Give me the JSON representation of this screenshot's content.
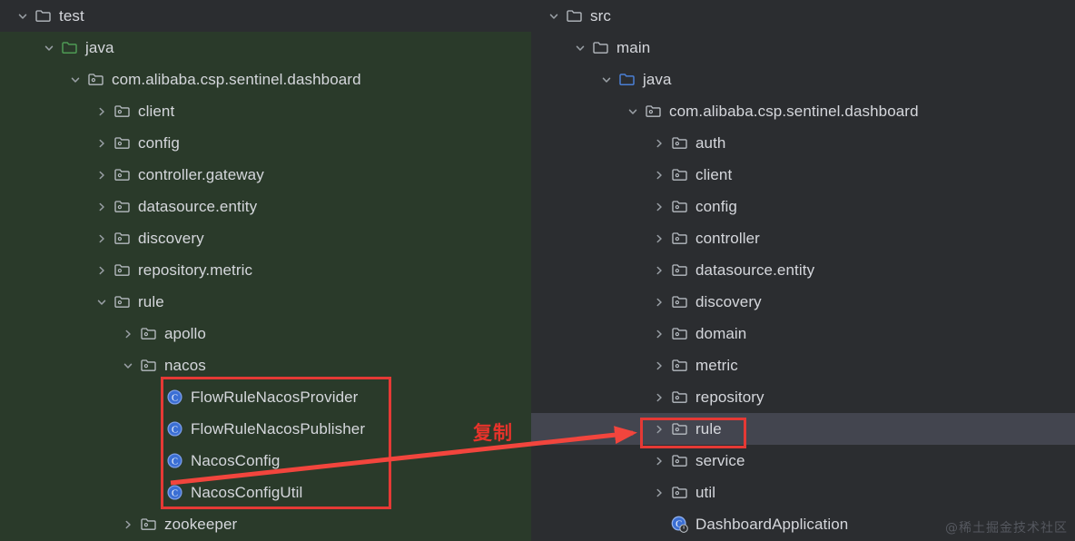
{
  "watermark": "@稀土掘金技术社区",
  "annotations": {
    "copy_label": "复制",
    "accent_red": "#e53935"
  },
  "colors": {
    "left_panel_bg": "#2a3a2a",
    "right_panel_bg": "#2b2d30",
    "selection_bg": "#43454f",
    "text": "#d5d7dc",
    "class_icon_blue": "#3b6fd4",
    "test_source_folder_green": "#4e9a54",
    "main_source_folder_blue": "#4a7fd4"
  },
  "left_panel": {
    "name": "test-sources-tree",
    "rows": [
      {
        "label": "test",
        "indent": 0,
        "toggle": "expanded",
        "icon": "folder-plain-icon"
      },
      {
        "label": "java",
        "indent": 1,
        "toggle": "expanded",
        "icon": "folder-test-source-icon"
      },
      {
        "label": "com.alibaba.csp.sentinel.dashboard",
        "indent": 2,
        "toggle": "expanded",
        "icon": "package-icon"
      },
      {
        "label": "client",
        "indent": 3,
        "toggle": "collapsed",
        "icon": "package-icon"
      },
      {
        "label": "config",
        "indent": 3,
        "toggle": "collapsed",
        "icon": "package-icon"
      },
      {
        "label": "controller.gateway",
        "indent": 3,
        "toggle": "collapsed",
        "icon": "package-icon"
      },
      {
        "label": "datasource.entity",
        "indent": 3,
        "toggle": "collapsed",
        "icon": "package-icon"
      },
      {
        "label": "discovery",
        "indent": 3,
        "toggle": "collapsed",
        "icon": "package-icon"
      },
      {
        "label": "repository.metric",
        "indent": 3,
        "toggle": "collapsed",
        "icon": "package-icon"
      },
      {
        "label": "rule",
        "indent": 3,
        "toggle": "expanded",
        "icon": "package-icon"
      },
      {
        "label": "apollo",
        "indent": 4,
        "toggle": "collapsed",
        "icon": "package-icon"
      },
      {
        "label": "nacos",
        "indent": 4,
        "toggle": "expanded",
        "icon": "package-icon"
      },
      {
        "label": "FlowRuleNacosProvider",
        "indent": 5,
        "toggle": "none",
        "icon": "java-class-icon"
      },
      {
        "label": "FlowRuleNacosPublisher",
        "indent": 5,
        "toggle": "none",
        "icon": "java-class-icon"
      },
      {
        "label": "NacosConfig",
        "indent": 5,
        "toggle": "none",
        "icon": "java-class-icon"
      },
      {
        "label": "NacosConfigUtil",
        "indent": 5,
        "toggle": "none",
        "icon": "java-class-icon"
      },
      {
        "label": "zookeeper",
        "indent": 4,
        "toggle": "collapsed",
        "icon": "package-icon"
      }
    ]
  },
  "right_panel": {
    "name": "main-sources-tree",
    "rows": [
      {
        "label": "src",
        "indent": 0,
        "toggle": "expanded",
        "icon": "folder-plain-icon",
        "selected": false
      },
      {
        "label": "main",
        "indent": 1,
        "toggle": "expanded",
        "icon": "folder-plain-icon",
        "selected": false
      },
      {
        "label": "java",
        "indent": 2,
        "toggle": "expanded",
        "icon": "folder-main-source-icon",
        "selected": false
      },
      {
        "label": "com.alibaba.csp.sentinel.dashboard",
        "indent": 3,
        "toggle": "expanded",
        "icon": "package-icon",
        "selected": false
      },
      {
        "label": "auth",
        "indent": 4,
        "toggle": "collapsed",
        "icon": "package-icon",
        "selected": false
      },
      {
        "label": "client",
        "indent": 4,
        "toggle": "collapsed",
        "icon": "package-icon",
        "selected": false
      },
      {
        "label": "config",
        "indent": 4,
        "toggle": "collapsed",
        "icon": "package-icon",
        "selected": false
      },
      {
        "label": "controller",
        "indent": 4,
        "toggle": "collapsed",
        "icon": "package-icon",
        "selected": false
      },
      {
        "label": "datasource.entity",
        "indent": 4,
        "toggle": "collapsed",
        "icon": "package-icon",
        "selected": false
      },
      {
        "label": "discovery",
        "indent": 4,
        "toggle": "collapsed",
        "icon": "package-icon",
        "selected": false
      },
      {
        "label": "domain",
        "indent": 4,
        "toggle": "collapsed",
        "icon": "package-icon",
        "selected": false
      },
      {
        "label": "metric",
        "indent": 4,
        "toggle": "collapsed",
        "icon": "package-icon",
        "selected": false
      },
      {
        "label": "repository",
        "indent": 4,
        "toggle": "collapsed",
        "icon": "package-icon",
        "selected": false
      },
      {
        "label": "rule",
        "indent": 4,
        "toggle": "collapsed",
        "icon": "package-icon",
        "selected": true
      },
      {
        "label": "service",
        "indent": 4,
        "toggle": "collapsed",
        "icon": "package-icon",
        "selected": false
      },
      {
        "label": "util",
        "indent": 4,
        "toggle": "collapsed",
        "icon": "package-icon",
        "selected": false
      },
      {
        "label": "DashboardApplication",
        "indent": 4,
        "toggle": "none",
        "icon": "spring-boot-class-icon",
        "selected": false
      }
    ]
  }
}
